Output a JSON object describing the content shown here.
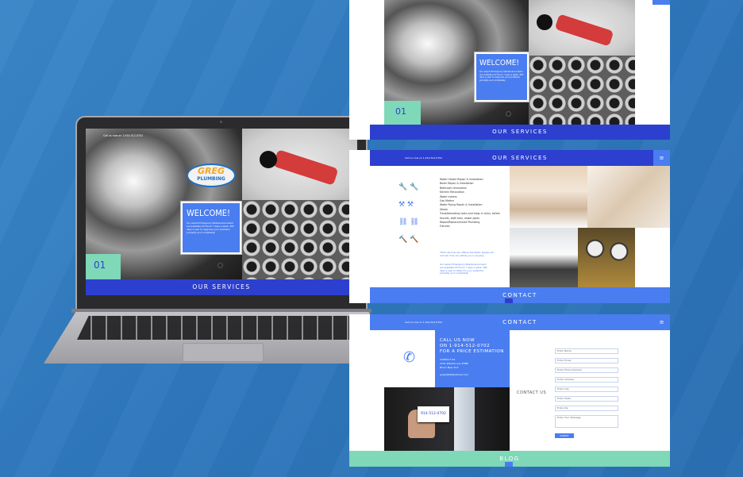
{
  "colors": {
    "background": "#2f78bd",
    "accent_blue": "#4a7df0",
    "dark_blue": "#2d3fcf",
    "teal": "#7fd8b8"
  },
  "laptop": {
    "phone_line": "Call us now on 1-914-512-0702",
    "logo_line1": "GREG",
    "logo_line2": "PLUMBING",
    "welcome_title": "WELCOME!",
    "welcome_text": "Our expert Emergency Maintenance team are available 24 Hours 7 days a week, 365 days a year to diagnose your problems promptly and completely!",
    "scroll_label": "scroll down",
    "slide_number": "01",
    "bottom_bar": "OUR SERVICES"
  },
  "panel1": {
    "welcome_title": "WELCOME!",
    "welcome_text": "Our expert Emergency Maintenance team are available 24 Hours 7 days a week, 365 days a year to diagnose your problems promptly and completely.",
    "scroll_label": "scroll down",
    "slide_number": "01",
    "bottom_bar": "OUR SERVICES"
  },
  "panel2": {
    "phone_line": "Call us now on 1-914-512-0702",
    "title": "OUR SERVICES",
    "menu_icon": "hamburger-icon",
    "services": [
      "Water Heater Repair & Installation",
      "Boiler Repair & Installation",
      "Bathroom renovation",
      "Kitchen Renovation",
      "Water meters",
      "Gas Meters",
      "Water Piping Repair & Installation",
      "Steam",
      "Troubleshooting leaks and clogs in sinks, toilets",
      "faucets, bath tubs, sewer pipes",
      "Repair/Replace/Install Plumbing",
      "Fixtures"
    ],
    "note1": "*More services are offered but listed, please call and ask if we can satisfy you in anyway.",
    "note2": "Our expert Emergency Maintenance team are available 24 Hours 7 days a week, 365 days a year to attend to your problems promptly and completely!",
    "bottom_bar": "CONTACT"
  },
  "panel3": {
    "phone_line": "Call us now on 1-914-512-0702",
    "title": "CONTACT",
    "menu_icon": "hamburger-icon",
    "call_lines": [
      "CALL US NOW",
      "ON 1-914-512-0702",
      "FOR A PRICE ESTIMATION"
    ],
    "contact_heading": "CONTACT US",
    "address_lines": [
      "2331 Roberts ave #3BE",
      "Bronx New York"
    ],
    "email": "greg1602@hotmail.com",
    "side_label": "CONTACT US",
    "card_text": "914-512-0702",
    "form_placeholders": [
      "Enter Name",
      "Enter Email",
      "Enter Phone Number",
      "Enter Address",
      "Enter City",
      "Enter State",
      "Enter Zip",
      "Enter Your Message"
    ],
    "submit_label": "SUBMIT",
    "bottom_bar": "BLOG"
  }
}
